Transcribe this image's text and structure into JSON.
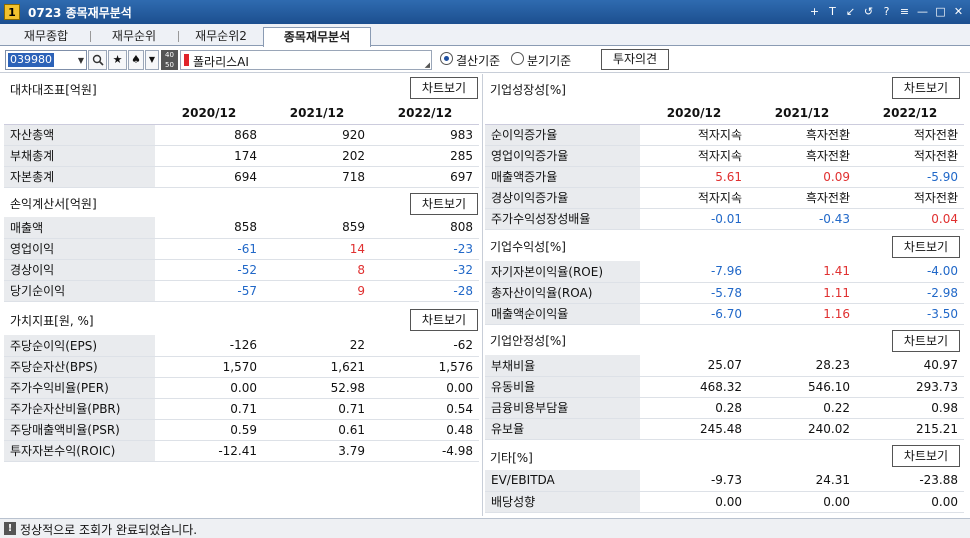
{
  "window": {
    "number": "1",
    "title": "0723 종목재무분석"
  },
  "tabs": [
    "재무종합",
    "재무순위",
    "재무순위2",
    "종목재무분석"
  ],
  "toolbar": {
    "code": "039980",
    "stack_label": "40 50",
    "name": "폴라리스AI",
    "radio1": "결산기준",
    "radio2": "분기기준",
    "opinion_btn": "투자의견",
    "star": "★",
    "spade": "♠"
  },
  "chart_btn": "차트보기",
  "years": [
    "2020/12",
    "2021/12",
    "2022/12"
  ],
  "left": {
    "balance": {
      "title": "대차대조표[억원]",
      "rows": [
        {
          "label": "자산총액",
          "v": [
            "868",
            "920",
            "983"
          ],
          "c": [
            "",
            "",
            ""
          ]
        },
        {
          "label": "부채총계",
          "v": [
            "174",
            "202",
            "285"
          ],
          "c": [
            "",
            "",
            ""
          ]
        },
        {
          "label": "자본총계",
          "v": [
            "694",
            "718",
            "697"
          ],
          "c": [
            "",
            "",
            ""
          ]
        }
      ]
    },
    "income": {
      "title": "손익계산서[억원]",
      "rows": [
        {
          "label": "매출액",
          "v": [
            "858",
            "859",
            "808"
          ],
          "c": [
            "",
            "",
            ""
          ]
        },
        {
          "label": "영업이익",
          "v": [
            "-61",
            "14",
            "-23"
          ],
          "c": [
            "neg",
            "pos",
            "neg"
          ]
        },
        {
          "label": "경상이익",
          "v": [
            "-52",
            "8",
            "-32"
          ],
          "c": [
            "neg",
            "pos",
            "neg"
          ]
        },
        {
          "label": "당기순이익",
          "v": [
            "-57",
            "9",
            "-28"
          ],
          "c": [
            "neg",
            "pos",
            "neg"
          ]
        }
      ]
    },
    "value": {
      "title": "가치지표[원, %]",
      "rows": [
        {
          "label": "주당순이익(EPS)",
          "v": [
            "-126",
            "22",
            "-62"
          ],
          "c": [
            "",
            "",
            ""
          ]
        },
        {
          "label": "주당순자산(BPS)",
          "v": [
            "1,570",
            "1,621",
            "1,576"
          ],
          "c": [
            "",
            "",
            ""
          ]
        },
        {
          "label": "주가수익비율(PER)",
          "v": [
            "0.00",
            "52.98",
            "0.00"
          ],
          "c": [
            "",
            "",
            ""
          ]
        },
        {
          "label": "주가순자산비율(PBR)",
          "v": [
            "0.71",
            "0.71",
            "0.54"
          ],
          "c": [
            "",
            "",
            ""
          ]
        },
        {
          "label": "주당매출액비율(PSR)",
          "v": [
            "0.59",
            "0.61",
            "0.48"
          ],
          "c": [
            "",
            "",
            ""
          ]
        },
        {
          "label": "투자자본수익(ROIC)",
          "v": [
            "-12.41",
            "3.79",
            "-4.98"
          ],
          "c": [
            "",
            "",
            ""
          ]
        }
      ]
    }
  },
  "right": {
    "growth": {
      "title": "기업성장성[%]",
      "rows": [
        {
          "label": "순이익증가율",
          "v": [
            "적자지속",
            "흑자전환",
            "적자전환"
          ],
          "c": [
            "",
            "",
            ""
          ]
        },
        {
          "label": "영업이익증가율",
          "v": [
            "적자지속",
            "흑자전환",
            "적자전환"
          ],
          "c": [
            "",
            "",
            ""
          ]
        },
        {
          "label": "매출액증가율",
          "v": [
            "5.61",
            "0.09",
            "-5.90"
          ],
          "c": [
            "pos",
            "pos",
            "neg"
          ]
        },
        {
          "label": "경상이익증가율",
          "v": [
            "적자지속",
            "흑자전환",
            "적자전환"
          ],
          "c": [
            "",
            "",
            ""
          ]
        },
        {
          "label": "주가수익성장성배율",
          "v": [
            "-0.01",
            "-0.43",
            "0.04"
          ],
          "c": [
            "neg",
            "neg",
            "pos"
          ]
        }
      ]
    },
    "profit": {
      "title": "기업수익성[%]",
      "rows": [
        {
          "label": "자기자본이익율(ROE)",
          "v": [
            "-7.96",
            "1.41",
            "-4.00"
          ],
          "c": [
            "neg",
            "pos",
            "neg"
          ]
        },
        {
          "label": "총자산이익율(ROA)",
          "v": [
            "-5.78",
            "1.11",
            "-2.98"
          ],
          "c": [
            "neg",
            "pos",
            "neg"
          ]
        },
        {
          "label": "매출액순이익율",
          "v": [
            "-6.70",
            "1.16",
            "-3.50"
          ],
          "c": [
            "neg",
            "pos",
            "neg"
          ]
        }
      ]
    },
    "stability": {
      "title": "기업안정성[%]",
      "rows": [
        {
          "label": "부채비율",
          "v": [
            "25.07",
            "28.23",
            "40.97"
          ],
          "c": [
            "",
            "",
            ""
          ]
        },
        {
          "label": "유동비율",
          "v": [
            "468.32",
            "546.10",
            "293.73"
          ],
          "c": [
            "",
            "",
            ""
          ]
        },
        {
          "label": "금융비용부담율",
          "v": [
            "0.28",
            "0.22",
            "0.98"
          ],
          "c": [
            "",
            "",
            ""
          ]
        },
        {
          "label": "유보율",
          "v": [
            "245.48",
            "240.02",
            "215.21"
          ],
          "c": [
            "",
            "",
            ""
          ]
        }
      ]
    },
    "etc": {
      "title": "기타[%]",
      "rows": [
        {
          "label": "EV/EBITDA",
          "v": [
            "-9.73",
            "24.31",
            "-23.88"
          ],
          "c": [
            "",
            "",
            ""
          ]
        },
        {
          "label": "배당성향",
          "v": [
            "0.00",
            "0.00",
            "0.00"
          ],
          "c": [
            "",
            "",
            ""
          ]
        }
      ]
    }
  },
  "status": "정상적으로 조회가 완료되었습니다.",
  "icons": {
    "win": [
      "+",
      "T",
      "↙",
      "↺",
      "?",
      "≡",
      "—",
      "□",
      "✕"
    ]
  }
}
